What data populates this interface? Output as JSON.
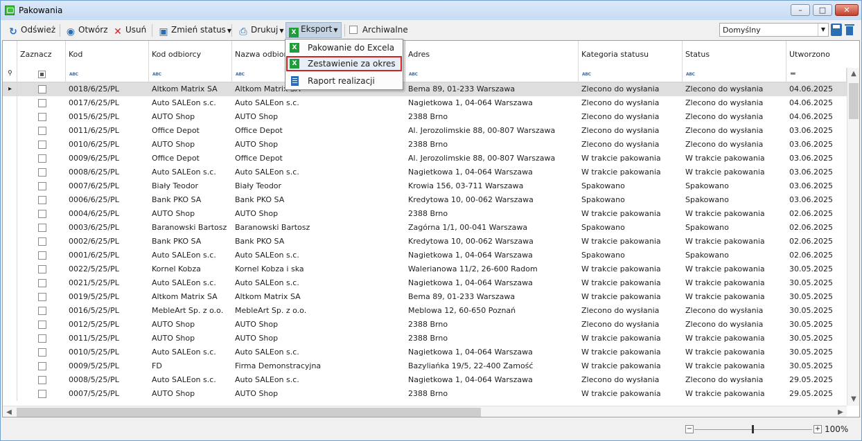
{
  "window": {
    "title": "Pakowania"
  },
  "toolbar": {
    "refresh": "Odśwież",
    "open": "Otwórz",
    "delete": "Usuń",
    "change_status": "Zmień status",
    "print": "Drukuj",
    "export": "Eksport",
    "archived": "Archiwalne",
    "view_select": "Domyślny"
  },
  "export_menu": {
    "items": [
      "Pakowanie do Excela",
      "Zestawienie za okres",
      "Raport realizacji"
    ],
    "highlighted": "Zestawienie za okres"
  },
  "columns": [
    "Zaznacz",
    "Kod",
    "Kod odbiorcy",
    "Nazwa odbiorcy",
    "Adres",
    "Kategoria statusu",
    "Status",
    "Utworzono"
  ],
  "rows": [
    [
      "0018/6/25/PL",
      "Altkom Matrix SA",
      "Altkom Matrix SA",
      "Bema 89, 01-233 Warszawa",
      "Zlecono do wysłania",
      "Zlecono do wysłania",
      "04.06.2025"
    ],
    [
      "0017/6/25/PL",
      "Auto SALEon s.c.",
      "Auto SALEon s.c.",
      "Nagietkowa 1, 04-064 Warszawa",
      "Zlecono do wysłania",
      "Zlecono do wysłania",
      "04.06.2025"
    ],
    [
      "0015/6/25/PL",
      "AUTO Shop",
      "AUTO Shop",
      "2388 Brno",
      "Zlecono do wysłania",
      "Zlecono do wysłania",
      "04.06.2025"
    ],
    [
      "0011/6/25/PL",
      "Office Depot",
      "Office Depot",
      "Al. Jerozolimskie 88, 00-807 Warszawa",
      "Zlecono do wysłania",
      "Zlecono do wysłania",
      "03.06.2025"
    ],
    [
      "0010/6/25/PL",
      "AUTO Shop",
      "AUTO Shop",
      "2388 Brno",
      "Zlecono do wysłania",
      "Zlecono do wysłania",
      "03.06.2025"
    ],
    [
      "0009/6/25/PL",
      "Office Depot",
      "Office Depot",
      "Al. Jerozolimskie 88, 00-807 Warszawa",
      "W trakcie pakowania",
      "W trakcie pakowania",
      "03.06.2025"
    ],
    [
      "0008/6/25/PL",
      "Auto SALEon s.c.",
      "Auto SALEon s.c.",
      "Nagietkowa 1, 04-064 Warszawa",
      "W trakcie pakowania",
      "W trakcie pakowania",
      "03.06.2025"
    ],
    [
      "0007/6/25/PL",
      "Biały Teodor",
      "Biały Teodor",
      "Krowia 156, 03-711 Warszawa",
      "Spakowano",
      "Spakowano",
      "03.06.2025"
    ],
    [
      "0006/6/25/PL",
      "Bank PKO SA",
      "Bank PKO SA",
      "Kredytowa 10, 00-062 Warszawa",
      "Spakowano",
      "Spakowano",
      "03.06.2025"
    ],
    [
      "0004/6/25/PL",
      "AUTO Shop",
      "AUTO Shop",
      "2388 Brno",
      "W trakcie pakowania",
      "W trakcie pakowania",
      "02.06.2025"
    ],
    [
      "0003/6/25/PL",
      "Baranowski Bartosz",
      "Baranowski Bartosz",
      "Zagórna 1/1, 00-041 Warszawa",
      "Spakowano",
      "Spakowano",
      "02.06.2025"
    ],
    [
      "0002/6/25/PL",
      "Bank PKO SA",
      "Bank PKO SA",
      "Kredytowa 10, 00-062 Warszawa",
      "W trakcie pakowania",
      "W trakcie pakowania",
      "02.06.2025"
    ],
    [
      "0001/6/25/PL",
      "Auto SALEon s.c.",
      "Auto SALEon s.c.",
      "Nagietkowa 1, 04-064 Warszawa",
      "Spakowano",
      "Spakowano",
      "02.06.2025"
    ],
    [
      "0022/5/25/PL",
      "Kornel Kobza",
      "Kornel Kobza i ska",
      "Walerianowa 11/2, 26-600 Radom",
      "W trakcie pakowania",
      "W trakcie pakowania",
      "30.05.2025"
    ],
    [
      "0021/5/25/PL",
      "Auto SALEon s.c.",
      "Auto SALEon s.c.",
      "Nagietkowa 1, 04-064 Warszawa",
      "W trakcie pakowania",
      "W trakcie pakowania",
      "30.05.2025"
    ],
    [
      "0019/5/25/PL",
      "Altkom Matrix SA",
      "Altkom Matrix SA",
      "Bema 89, 01-233 Warszawa",
      "W trakcie pakowania",
      "W trakcie pakowania",
      "30.05.2025"
    ],
    [
      "0016/5/25/PL",
      "MebleArt Sp. z o.o.",
      "MebleArt Sp. z o.o.",
      "Meblowa 12, 60-650 Poznań",
      "Zlecono do wysłania",
      "Zlecono do wysłania",
      "30.05.2025"
    ],
    [
      "0012/5/25/PL",
      "AUTO Shop",
      "AUTO Shop",
      "2388 Brno",
      "Zlecono do wysłania",
      "Zlecono do wysłania",
      "30.05.2025"
    ],
    [
      "0011/5/25/PL",
      "AUTO Shop",
      "AUTO Shop",
      "2388 Brno",
      "W trakcie pakowania",
      "W trakcie pakowania",
      "30.05.2025"
    ],
    [
      "0010/5/25/PL",
      "Auto SALEon s.c.",
      "Auto SALEon s.c.",
      "Nagietkowa 1, 04-064 Warszawa",
      "W trakcie pakowania",
      "W trakcie pakowania",
      "30.05.2025"
    ],
    [
      "0009/5/25/PL",
      "FD",
      "Firma Demonstracyjna",
      "Bazyliańka 19/5, 22-400 Zamość",
      "W trakcie pakowania",
      "W trakcie pakowania",
      "30.05.2025"
    ],
    [
      "0008/5/25/PL",
      "Auto SALEon s.c.",
      "Auto SALEon s.c.",
      "Nagietkowa 1, 04-064 Warszawa",
      "Zlecono do wysłania",
      "Zlecono do wysłania",
      "29.05.2025"
    ],
    [
      "0007/5/25/PL",
      "AUTO Shop",
      "AUTO Shop",
      "2388 Brno",
      "W trakcie pakowania",
      "W trakcie pakowania",
      "29.05.2025"
    ]
  ],
  "zoom": {
    "value": 1.0,
    "label": "100%"
  },
  "colors": {
    "selected_row": "#dedede",
    "menu_highlight_border": "#d32020",
    "excel_green": "#1f9d3b",
    "accent_blue": "#2a6db5"
  }
}
